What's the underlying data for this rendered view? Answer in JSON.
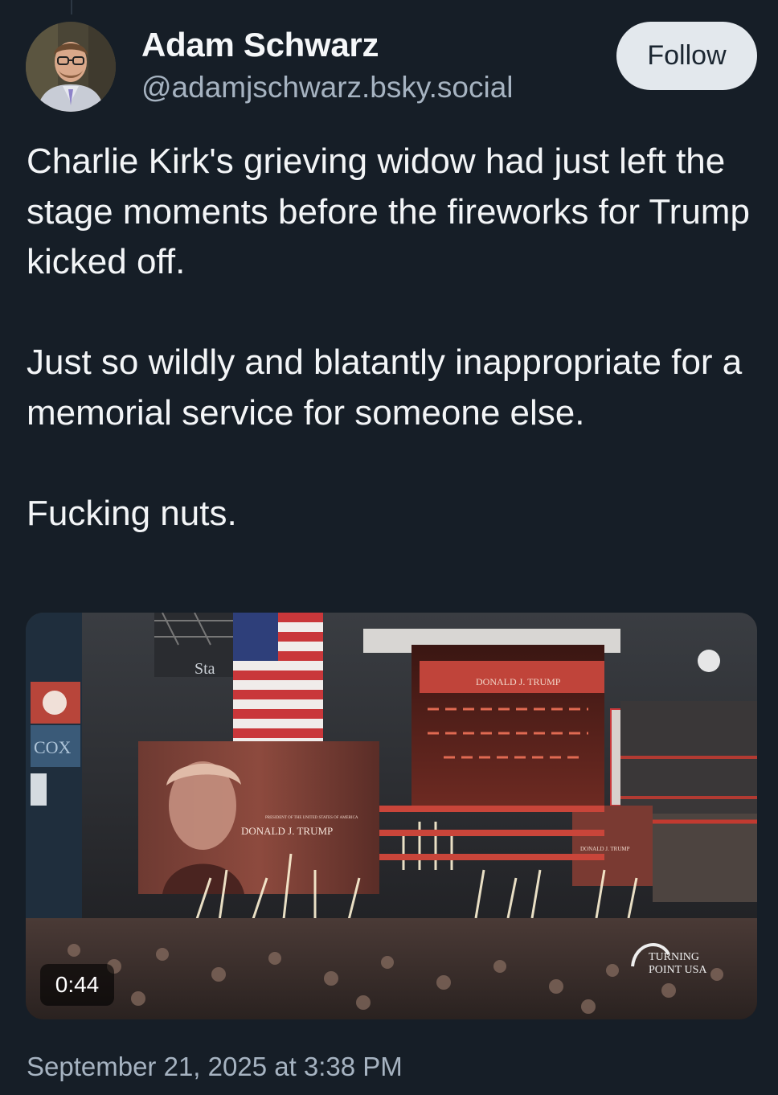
{
  "author": {
    "name": "Adam Schwarz",
    "handle": "@adamjschwarz.bsky.social"
  },
  "follow_label": "Follow",
  "post": {
    "paragraphs": [
      "Charlie Kirk's grieving widow had just left the stage moments before the fireworks for Trump kicked off.",
      "Just so wildly and blatantly inappropriate for a memorial service for someone else.",
      "Fucking nuts."
    ]
  },
  "video": {
    "duration": "0:44",
    "screen_left_name": "DONALD J. TRUMP",
    "screen_left_small": "PRESIDENT OF THE UNITED STATES OF AMERICA",
    "stage_banner": "DONALD J. TRUMP",
    "screen_right_name": "DONALD J. TRUMP",
    "sign_cox": "COX",
    "sign_sta": "Sta",
    "watermark_line1": "TURNING",
    "watermark_line2": "POINT USA"
  },
  "timestamp": "September 21, 2025 at 3:38 PM",
  "colors": {
    "background": "#161e27",
    "secondary_text": "#a6b3c1",
    "follow_bg": "#e3e8ed"
  }
}
